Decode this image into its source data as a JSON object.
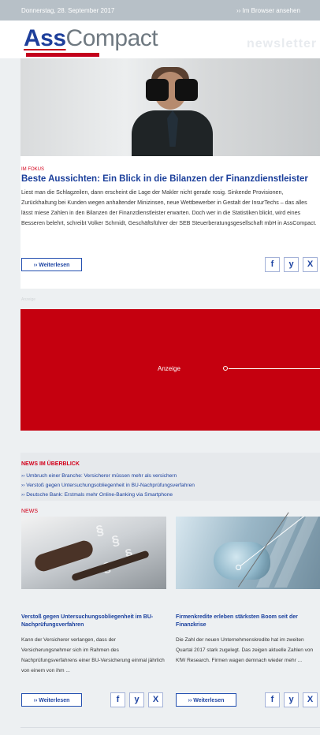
{
  "topbar": {
    "date": "Donnerstag, 28. September 2017",
    "browser_link": "›› Im Browser ansehen"
  },
  "header": {
    "logo_ass": "Ass",
    "logo_compact": "Compact",
    "newsletter": "newsletter"
  },
  "feature": {
    "kicker": "IM FOKUS",
    "title": "Beste Aussichten: Ein Blick in die Bilanzen der Finanzdienstleister",
    "body": "Liest man die Schlagzeilen, dann erscheint die Lage der Makler nicht gerade rosig. Sinkende Provisionen, Zurückhaltung bei Kunden wegen anhaltender Minizinsen, neue Wettbewerber in Gestalt der InsurTechs – das alles lässt miese Zahlen in den Bilanzen der Finanzdienstleister erwarten. Doch wer in die Statistiken blickt, wird eines Besseren belehrt, schreibt Volker Schmidt, Geschäftsführer der SEB Steuerberatungsgesellschaft mbH in AssCompact.",
    "button": "›› Weiterlesen"
  },
  "share_icons": [
    "f",
    "y",
    "X"
  ],
  "ad": {
    "label": "Anzeige",
    "caption": "Anzeige"
  },
  "news_overview": {
    "title": "NEWS IM ÜBERBLICK",
    "items": [
      "›› Umbruch einer Branche: Versicherer müssen mehr als versichern",
      "›› Verstoß gegen Untersuchungsobliegenheit in BU-Nachprüfungsverfahren",
      "›› Deutsche Bank: Erstmals mehr Online-Banking via Smartphone"
    ]
  },
  "news": {
    "label": "NEWS",
    "left": {
      "title": "Verstoß gegen Untersuchungsobliegenheit im BU-Nachprüfungsverfahren",
      "body": "Kann der Versicherer verlangen, dass der Versicherungsnehmer sich im Rahmen des Nachprüfungsverfahrens einer BU-Versicherung einmal jährlich von einem von ihm ...",
      "button": "›› Weiterlesen"
    },
    "right": {
      "title": "Firmenkredite erleben stärksten Boom seit der Finanzkrise",
      "body": "Die Zahl der neuen Unternehmenskredite hat im zweiten Quartal 2017 stark zugelegt. Das zeigen aktuelle Zahlen von KfW Research. Firmen wagen demnach wieder mehr ...",
      "button": "›› Weiterlesen"
    }
  },
  "colors": {
    "brand_blue": "#1b3f9b",
    "accent_red": "#d3001a",
    "ad_red": "#c5000f"
  }
}
